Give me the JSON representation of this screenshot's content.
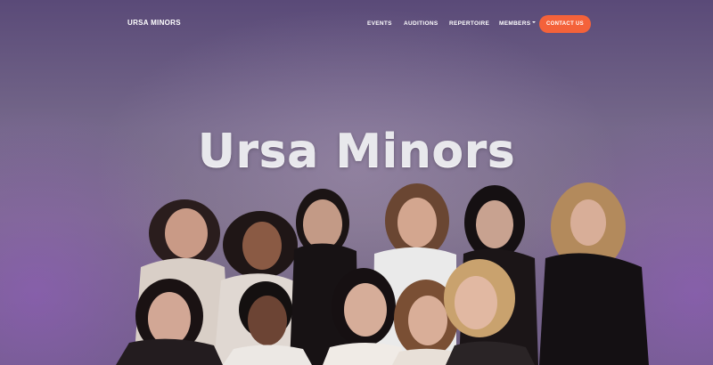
{
  "nav": {
    "brand": "URSA MINORS",
    "links": [
      "EVENTS",
      "AUDITIONS",
      "REPERTOIRE",
      "MEMBERS"
    ],
    "contact": "CONTACT US"
  },
  "hero": {
    "title": "Ursa Minors"
  },
  "colors": {
    "accent": "#f4623a",
    "background": "#6e5f86"
  }
}
